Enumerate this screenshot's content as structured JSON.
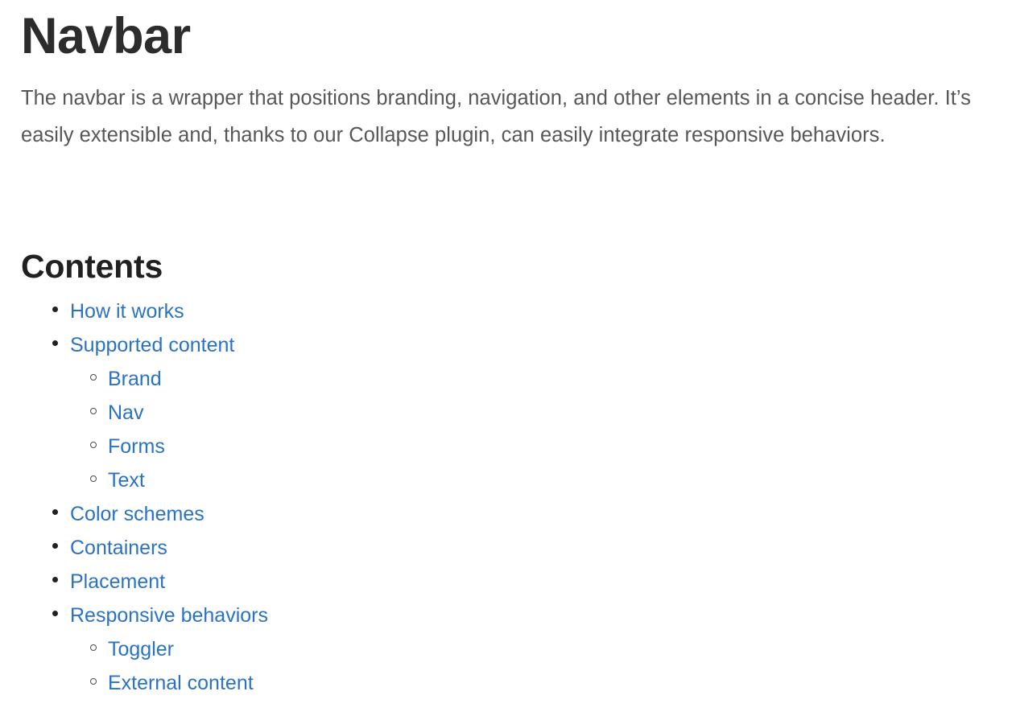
{
  "page": {
    "title": "Navbar",
    "intro": "The navbar is a wrapper that positions branding, navigation, and other elements in a concise header. It’s easily extensible and, thanks to our Collapse plugin, can easily integrate responsive behaviors.",
    "contents_heading": "Contents"
  },
  "colors": {
    "link": "#2a72c4",
    "heading": "#2c2c2c",
    "section_heading": "#202020",
    "body_text": "#575757",
    "background": "#ffffff",
    "bullet": "#212121"
  },
  "contents": {
    "items": [
      {
        "label": "How it works",
        "level": 1,
        "marker": "disc-bullet-icon",
        "children": []
      },
      {
        "label": "Supported content",
        "level": 1,
        "marker": "disc-bullet-icon",
        "children": [
          {
            "label": "Brand",
            "level": 2,
            "marker": "circle-bullet-icon"
          },
          {
            "label": "Nav",
            "level": 2,
            "marker": "circle-bullet-icon"
          },
          {
            "label": "Forms",
            "level": 2,
            "marker": "circle-bullet-icon"
          },
          {
            "label": "Text",
            "level": 2,
            "marker": "circle-bullet-icon"
          }
        ]
      },
      {
        "label": "Color schemes",
        "level": 1,
        "marker": "disc-bullet-icon",
        "children": []
      },
      {
        "label": "Containers",
        "level": 1,
        "marker": "disc-bullet-icon",
        "children": []
      },
      {
        "label": "Placement",
        "level": 1,
        "marker": "disc-bullet-icon",
        "children": []
      },
      {
        "label": "Responsive behaviors",
        "level": 1,
        "marker": "disc-bullet-icon",
        "children": [
          {
            "label": "Toggler",
            "level": 2,
            "marker": "circle-bullet-icon"
          },
          {
            "label": "External content",
            "level": 2,
            "marker": "circle-bullet-icon"
          }
        ]
      }
    ]
  }
}
